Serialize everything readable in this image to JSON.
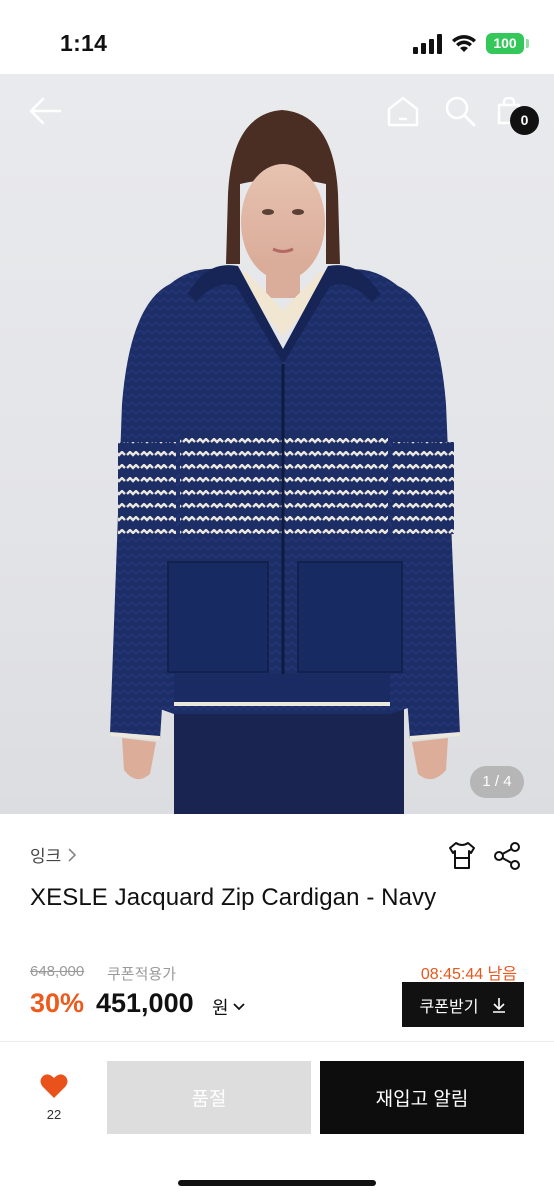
{
  "status_bar": {
    "time": "1:14",
    "battery": "100"
  },
  "header": {
    "cart_count": "0"
  },
  "gallery": {
    "counter": "1 / 4"
  },
  "product": {
    "brand": "잉크",
    "title": "XESLE Jacquard Zip Cardigan - Navy",
    "original_price": "648,000",
    "coupon_note": "쿠폰적용가",
    "timer": "08:45:44 남음",
    "discount": "30%",
    "sale_price": "451,000",
    "currency": "원",
    "coupon_button": "쿠폰받기"
  },
  "bottom_bar": {
    "like_count": "22",
    "soldout_label": "품절",
    "restock_label": "재입고 알림"
  },
  "colors": {
    "accent": "#ec5a1c",
    "like": "#e9521b",
    "dark": "#111111",
    "navy": "#1b2c63"
  },
  "icons": [
    "back-arrow-icon",
    "home-icon",
    "search-icon",
    "shopping-bag-icon",
    "fit-guide-icon",
    "share-icon",
    "chevron-right-icon",
    "chevron-down-icon",
    "download-icon",
    "heart-icon"
  ]
}
